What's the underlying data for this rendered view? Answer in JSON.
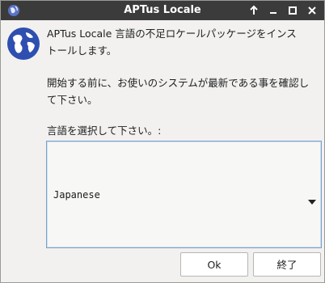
{
  "window": {
    "title": "APTus Locale",
    "titlebar_color": "#3b3b3b"
  },
  "message": {
    "line1a": "APTus Locale 言語の不足ロケールパッケージをインス",
    "line1b": "トールします。",
    "line2a": "開始する前に、お使いのシステムが最新である事を確認し",
    "line2b": "て下さい。"
  },
  "language": {
    "prompt": "言語を選択して下さい。:",
    "selected": "Japanese"
  },
  "buttons": {
    "ok": "Ok",
    "exit": "終了"
  },
  "icons": {
    "app": "app-logo-icon",
    "globe": "globe-icon",
    "up": "arrow-up-icon",
    "minimize": "minimize-icon",
    "maximize": "maximize-icon",
    "close": "close-icon",
    "dropdown": "chevron-down-icon"
  },
  "colors": {
    "accent": "#2e4fb0",
    "focus_border": "#7aa0c9"
  }
}
